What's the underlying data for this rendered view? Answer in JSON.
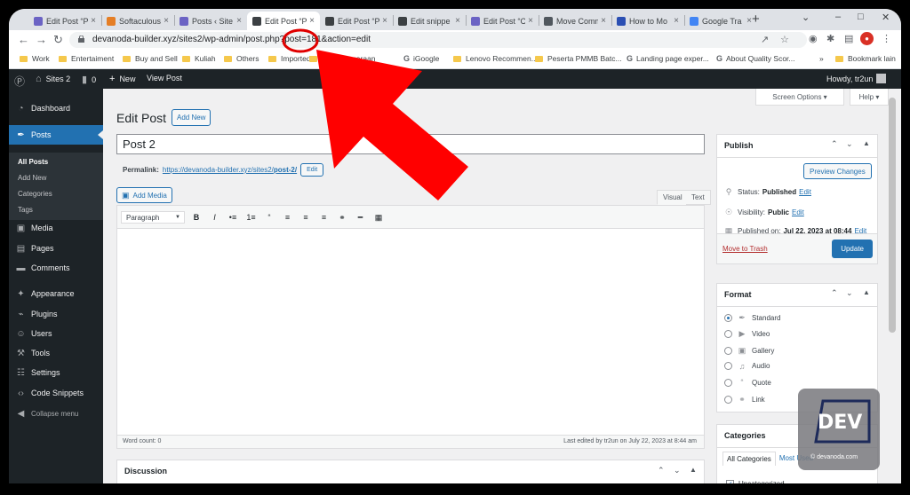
{
  "browser": {
    "tabs": [
      {
        "label": "Edit Post “P",
        "fav": "#6b63c4"
      },
      {
        "label": "Softaculous",
        "fav": "#e57e25"
      },
      {
        "label": "Posts ‹ Site",
        "fav": "#6b63c4"
      },
      {
        "label": "Edit Post “P",
        "fav": "#3c4043",
        "active": true
      },
      {
        "label": "Edit Post “P",
        "fav": "#3c4043"
      },
      {
        "label": "Edit snippe",
        "fav": "#3c4043"
      },
      {
        "label": "Edit Post “C",
        "fav": "#6b63c4"
      },
      {
        "label": "Move Comm",
        "fav": "#50575e"
      },
      {
        "label": "How to Mo",
        "fav": "#2b4fb3"
      },
      {
        "label": "Google Tra",
        "fav": "#4285f4"
      }
    ],
    "new_tab": "+",
    "url": "devanoda-builder.xyz/sites2/wp-admin/post.php?post=181&action=edit",
    "bookmarks": [
      {
        "label": "Work",
        "type": "folder"
      },
      {
        "label": "Entertaiment",
        "type": "folder"
      },
      {
        "label": "Buy and Sell",
        "type": "folder"
      },
      {
        "label": "Kuliah",
        "type": "folder"
      },
      {
        "label": "Others",
        "type": "folder"
      },
      {
        "label": "Imported",
        "type": "folder"
      },
      {
        "label": "Ketatanegaraan",
        "type": "folder"
      },
      {
        "label": "iGoogle",
        "type": "google"
      },
      {
        "label": "Lenovo Recommen...",
        "type": "folder"
      },
      {
        "label": "Peserta PMMB Batc...",
        "type": "folder"
      },
      {
        "label": "Landing page exper...",
        "type": "google"
      },
      {
        "label": "About Quality Scor...",
        "type": "google"
      },
      {
        "label": "Bookmark lain",
        "type": "folder"
      }
    ],
    "bookmarks_more": "»"
  },
  "adminbar": {
    "site_name": "Sites 2",
    "comments_count": "0",
    "new_label": "New",
    "view_post": "View Post",
    "howdy": "Howdy, tr2un"
  },
  "sidebar": {
    "items": [
      {
        "label": "Dashboard",
        "icon": "dashboard-icon",
        "glyph": "◔"
      },
      {
        "label": "Posts",
        "icon": "pin-icon",
        "glyph": "✒"
      },
      {
        "label": "Media",
        "icon": "media-icon",
        "glyph": "▣"
      },
      {
        "label": "Pages",
        "icon": "page-icon",
        "glyph": "▤"
      },
      {
        "label": "Comments",
        "icon": "comment-icon",
        "glyph": "▬"
      },
      {
        "label": "Appearance",
        "icon": "brush-icon",
        "glyph": "✦"
      },
      {
        "label": "Plugins",
        "icon": "plugin-icon",
        "glyph": "⌁"
      },
      {
        "label": "Users",
        "icon": "user-icon",
        "glyph": "☺"
      },
      {
        "label": "Tools",
        "icon": "wrench-icon",
        "glyph": "⚒"
      },
      {
        "label": "Settings",
        "icon": "settings-icon",
        "glyph": "☷"
      },
      {
        "label": "Code Snippets",
        "icon": "code-icon",
        "glyph": "‹›"
      },
      {
        "label": "Collapse menu",
        "icon": "collapse-icon",
        "glyph": "◀"
      }
    ],
    "posts_sub": [
      "All Posts",
      "Add New",
      "Categories",
      "Tags"
    ]
  },
  "main": {
    "screen_options": "Screen Options ▾",
    "help": "Help ▾",
    "title": "Edit Post",
    "add_new": "Add New",
    "post_title": "Post 2",
    "permalink_label": "Permalink:",
    "permalink_url": "https://devanoda-builder.xyz/sites2/",
    "permalink_slug": "post-2/",
    "permalink_edit": "Edit",
    "add_media": "Add Media",
    "tab_visual": "Visual",
    "tab_text": "Text",
    "format": "Paragraph",
    "toolbar": [
      "B",
      "I",
      "•≡",
      "1≡",
      "“",
      "≡",
      "≡",
      "≡",
      "⚭",
      "━",
      "▦"
    ],
    "word_count": "Word count: 0",
    "last_edited": "Last edited by tr2un on July 22, 2023 at 8:44 am",
    "discussion": "Discussion"
  },
  "publish": {
    "title": "Publish",
    "preview": "Preview Changes",
    "status_label": "Status:",
    "status": "Published",
    "visibility_label": "Visibility:",
    "visibility": "Public",
    "published_label": "Published on:",
    "published_on": "Jul 22, 2023 at 08:44",
    "edit": "Edit",
    "trash": "Move to Trash",
    "update": "Update"
  },
  "format_box": {
    "title": "Format",
    "options": [
      "Standard",
      "Video",
      "Gallery",
      "Audio",
      "Quote",
      "Link"
    ]
  },
  "categories_box": {
    "title": "Categories",
    "tab_all": "All Categories",
    "tab_most": "Most Used",
    "item": "Uncategorized"
  },
  "watermark": {
    "logo_text": "DEV",
    "credit": "© devanoda.com"
  },
  "colors": {
    "wp_blue": "#2271b1",
    "admin_dark": "#1d2327",
    "annotation_red": "#ff0000"
  }
}
